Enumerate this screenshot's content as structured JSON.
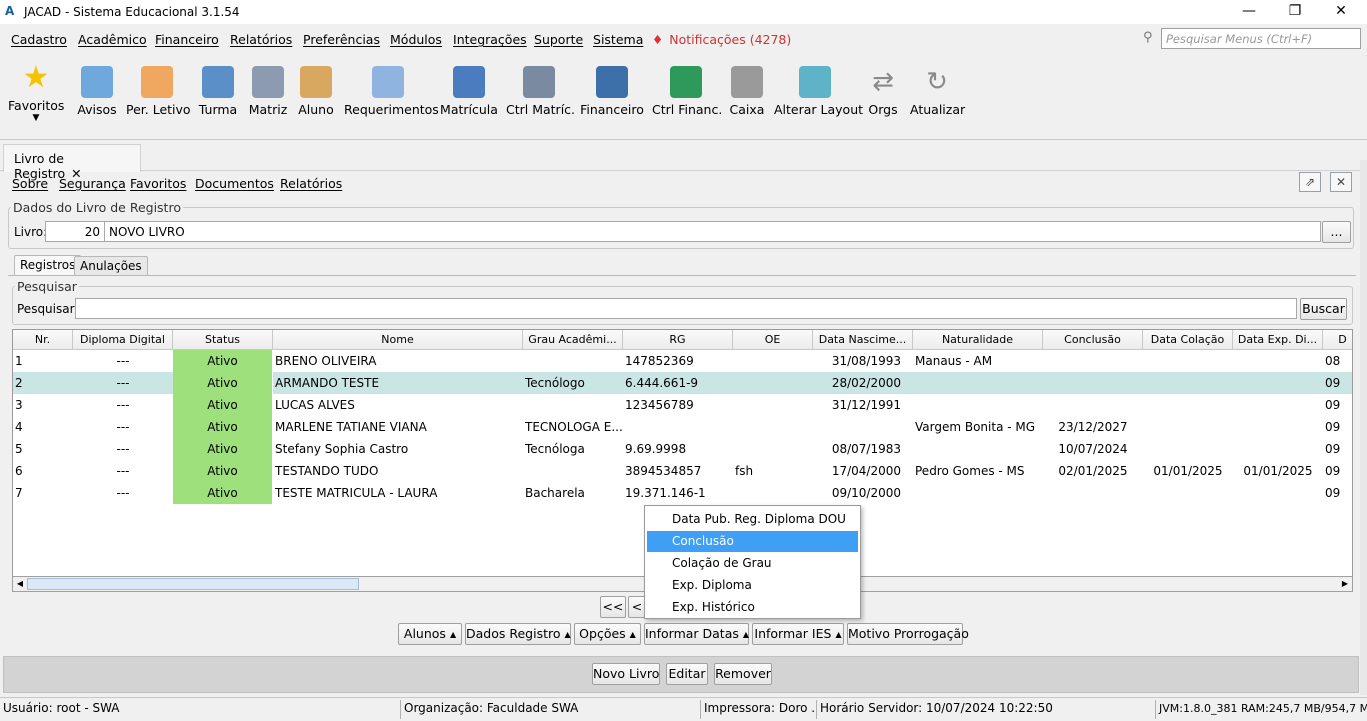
{
  "window": {
    "title": "JACAD - Sistema Educacional 3.1.54",
    "logo": "A"
  },
  "menus": [
    {
      "pre": "",
      "u": "C",
      "rest": "adastro"
    },
    {
      "pre": "",
      "u": "A",
      "rest": "cadêmico"
    },
    {
      "pre": "",
      "u": "F",
      "rest": "inanceiro"
    },
    {
      "pre": "",
      "u": "R",
      "rest": "elatórios"
    },
    {
      "pre": "",
      "u": "P",
      "rest": "referências"
    },
    {
      "pre": "",
      "u": "M",
      "rest": "ódulos"
    },
    {
      "pre": "",
      "u": "I",
      "rest": "ntegrações"
    },
    {
      "pre": "",
      "u": "S",
      "rest": "uporte"
    },
    {
      "pre": "",
      "u": "S",
      "rest": "istema"
    }
  ],
  "notifications": "Notificações (4278)",
  "menu_search_placeholder": "Pesquisar Menus (Ctrl+F)",
  "toolbar": [
    "Favoritos",
    "Avisos",
    "Per. Letivo",
    "Turma",
    "Matriz",
    "Aluno",
    "Requerimentos",
    "Matrícula",
    "Ctrl Matríc.",
    "Financeiro",
    "Ctrl Financ.",
    "Caixa",
    "Alterar Layout",
    "Orgs",
    "Atualizar"
  ],
  "tab": {
    "label": "Livro de Registro",
    "close": "✕"
  },
  "submenu": [
    "Sobre",
    "Segurança",
    "Favoritos",
    "Documentos",
    "Relatórios"
  ],
  "livro": {
    "legend": "Dados do Livro de Registro",
    "label": "Livro:",
    "number": "20",
    "name": "NOVO LIVRO",
    "browse": "..."
  },
  "inner_tabs": [
    "Registros",
    "Anulações"
  ],
  "pesquisa": {
    "legend": "Pesquisar",
    "label": "Pesquisar:",
    "value": "",
    "button": "Buscar"
  },
  "grid": {
    "columns": [
      "Nr.",
      "Diploma Digital",
      "Status",
      "Nome",
      "Grau Acadêmi...",
      "RG",
      "OE",
      "Data Nascime...",
      "Naturalidade",
      "Conclusão",
      "Data Colação",
      "Data Exp. Di...",
      "D"
    ],
    "rows": [
      [
        "1",
        "---",
        "Ativo",
        "BRENO OLIVEIRA",
        "",
        "147852369",
        "",
        "31/08/1993",
        "Manaus - AM",
        "",
        "",
        "",
        "08"
      ],
      [
        "2",
        "---",
        "Ativo",
        "ARMANDO TESTE",
        "Tecnólogo",
        "6.444.661-9",
        "",
        "28/02/2000",
        "",
        "",
        "",
        "",
        "09"
      ],
      [
        "3",
        "---",
        "Ativo",
        "LUCAS ALVES",
        "",
        "123456789",
        "",
        "31/12/1991",
        "",
        "",
        "",
        "",
        "09"
      ],
      [
        "4",
        "---",
        "Ativo",
        "MARLENE TATIANE VIANA",
        "TECNOLOGA E...",
        "",
        "",
        "",
        "Vargem Bonita - MG",
        "23/12/2027",
        "",
        "",
        "09"
      ],
      [
        "5",
        "---",
        "Ativo",
        "Stefany Sophia Castro",
        "Tecnóloga",
        "9.69.9998",
        "",
        "08/07/1983",
        "",
        "10/07/2024",
        "",
        "",
        "09"
      ],
      [
        "6",
        "---",
        "Ativo",
        "TESTANDO TUDO",
        "",
        "3894534857",
        "fsh",
        "17/04/2000",
        "Pedro Gomes - MS",
        "02/01/2025",
        "01/01/2025",
        "01/01/2025",
        "09"
      ],
      [
        "7",
        "---",
        "Ativo",
        "TESTE MATRICULA - LAURA",
        "Bacharela",
        "19.371.146-1",
        "",
        "09/10/2000",
        "",
        "",
        "",
        "",
        "09"
      ]
    ]
  },
  "pager": {
    "first": "<<",
    "prev": "<"
  },
  "context_menu": [
    "Data Pub. Reg. Diploma DOU",
    "Conclusão",
    "Colação de Grau",
    "Exp. Diploma",
    "Exp. Histórico"
  ],
  "action_buttons": [
    "Alunos",
    "Dados Registro",
    "Opções",
    "Informar Datas",
    "Informar IES",
    "Motivo Prorrogação"
  ],
  "bottom_buttons": [
    "Novo Livro",
    "Editar",
    "Remover"
  ],
  "status": {
    "user": "Usuário: root - SWA",
    "org": "Organização: Faculdade SWA",
    "printer": "Impressora: Doro ...",
    "server": "Horário Servidor: 10/07/2024 10:22:50",
    "jvm": "JVM:1.8.0_381  RAM:245,7 MB/954,7 MB"
  }
}
